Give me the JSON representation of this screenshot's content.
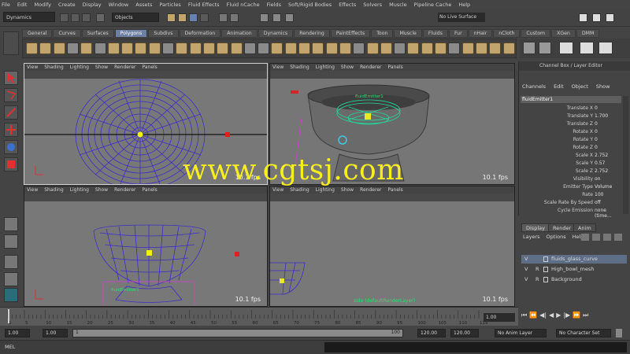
{
  "menubar": [
    "File",
    "Edit",
    "Modify",
    "Create",
    "Display",
    "Window",
    "Assets",
    "Particles",
    "Fluid Effects",
    "Fluid nCache",
    "Fields",
    "Soft/Rigid Bodies",
    "Effects",
    "Solvers",
    "Muscle",
    "Pipeline Cache",
    "Help"
  ],
  "status": {
    "mode": "Dynamics",
    "objects_field": "Objects",
    "render_field": "No Live Surface"
  },
  "shelf_tabs": [
    "General",
    "Curves",
    "Surfaces",
    "Polygons",
    "Subdivs",
    "Deformation",
    "Animation",
    "Dynamics",
    "Rendering",
    "PaintEffects",
    "Toon",
    "Muscle",
    "Fluids",
    "Fur",
    "nHair",
    "nCloth",
    "Custom",
    "XGen",
    "DMM"
  ],
  "shelf_active": "Polygons",
  "viewport_menu": [
    "View",
    "Shading",
    "Lighting",
    "Show",
    "Renderer",
    "Panels"
  ],
  "viewports": [
    {
      "fps": "10.1 fps"
    },
    {
      "fps": "10.1 fps"
    },
    {
      "fps": "10.1 fps"
    },
    {
      "fps": "10.1 fps"
    }
  ],
  "vp2_label": "fluidEmitter1",
  "vp4_label": "side (defaultRenderLayer)",
  "vp3_label": "fluidEmitter1",
  "watermark": "www.cgtsj.com",
  "channel_box": {
    "title": "Channel Box / Layer Editor",
    "menu": [
      "Channels",
      "Edit",
      "Object",
      "Show"
    ],
    "object": "fluidEmitter1",
    "attrs": [
      {
        "name": "Translate X",
        "value": "0"
      },
      {
        "name": "Translate Y",
        "value": "1.700"
      },
      {
        "name": "Translate Z",
        "value": "0"
      },
      {
        "name": "Rotate X",
        "value": "0"
      },
      {
        "name": "Rotate Y",
        "value": "0"
      },
      {
        "name": "Rotate Z",
        "value": "0"
      },
      {
        "name": "Scale X",
        "value": "2.752"
      },
      {
        "name": "Scale Y",
        "value": "0.57"
      },
      {
        "name": "Scale Z",
        "value": "2.752"
      },
      {
        "name": "Visibility",
        "value": "on"
      },
      {
        "name": "Emitter Type",
        "value": "Volume"
      },
      {
        "name": "Rate",
        "value": "100"
      },
      {
        "name": "Scale Rate By Speed",
        "value": "off"
      },
      {
        "name": "Cycle Emission",
        "value": "none (time..."
      }
    ]
  },
  "layer_editor": {
    "tabs": [
      "Display",
      "Render",
      "Anim"
    ],
    "menu": [
      "Layers",
      "Options",
      "Help"
    ],
    "layers": [
      {
        "v": "V",
        "r": "",
        "name": "fluids_glass_curve",
        "selected": true
      },
      {
        "v": "V",
        "r": "R",
        "name": "High_bowl_mesh",
        "selected": false
      },
      {
        "v": "V",
        "r": "R",
        "name": "Background",
        "selected": false
      }
    ]
  },
  "timeline": {
    "ticks": [
      "1",
      "5",
      "10",
      "15",
      "20",
      "25",
      "30",
      "35",
      "40",
      "45",
      "50",
      "55",
      "60",
      "65",
      "70",
      "75",
      "80",
      "85",
      "90",
      "95",
      "100",
      "105",
      "110",
      "115"
    ],
    "current": "1.00"
  },
  "range": {
    "start": "1.00",
    "inner_start": "1.00",
    "handle": "1",
    "inner_end": "100",
    "end1": "120.00",
    "end2": "120.00",
    "anim_layer": "No Anim Layer",
    "character": "No Character Set"
  },
  "cmd_label": "MEL"
}
